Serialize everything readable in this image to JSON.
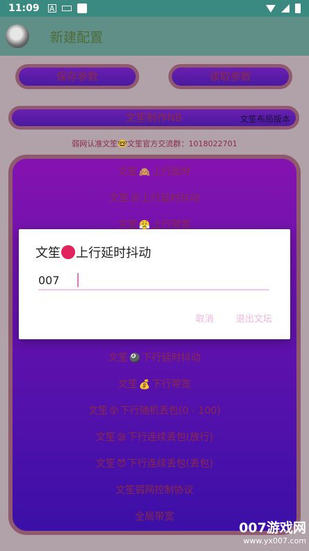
{
  "status_bar": {
    "time": "11:09",
    "a_icon": "A"
  },
  "app_bar": {
    "title": "新建配置"
  },
  "buttons": {
    "save_params": "保存参数",
    "read_params": "读取参数",
    "wide_button": "文笙制作NB",
    "version_tag": "文笙布局版本"
  },
  "notice": "弱网认准文笙🤓文笙官方交流群：1018022701",
  "options": [
    {
      "prefix": "文笙",
      "emoji": "🙈",
      "text": "上行延时"
    },
    {
      "prefix": "文笙",
      "emoji": "😡",
      "text": "上行延时抖动"
    },
    {
      "prefix": "文笙",
      "emoji": "😤",
      "text": "上行带宽"
    },
    {
      "prefix": "文笙",
      "emoji": "🎱",
      "text": "下行延时抖动"
    },
    {
      "prefix": "文笙",
      "emoji": "💰",
      "text": "下行带宽"
    },
    {
      "prefix": "文笙",
      "emoji": "😵",
      "text": "下行随机丢包(0 - 100)"
    },
    {
      "prefix": "文笙",
      "emoji": "😪",
      "text": "下行连续丢包(放行)"
    },
    {
      "prefix": "文笙",
      "emoji": "😈",
      "text": "下行连续丢包(丢包)"
    },
    {
      "prefix": "",
      "emoji": "",
      "text": "文笙弱网控制协议"
    },
    {
      "prefix": "",
      "emoji": "",
      "text": "全局带宽"
    }
  ],
  "dialog": {
    "title_prefix": "文笙",
    "title_suffix": "上行延时抖动",
    "input_value": "007",
    "cancel_label": "取消",
    "exit_label": "退出文坛"
  },
  "watermark": {
    "brand": "007游戏网",
    "url": "www.yx007.com"
  },
  "colors": {
    "status_bar": "#3a8a82",
    "app_bar": "#5f8f86",
    "panel_top": "#8413b0",
    "panel_bottom": "#3b10a8",
    "dialog_accent": "#f3c8e6"
  }
}
